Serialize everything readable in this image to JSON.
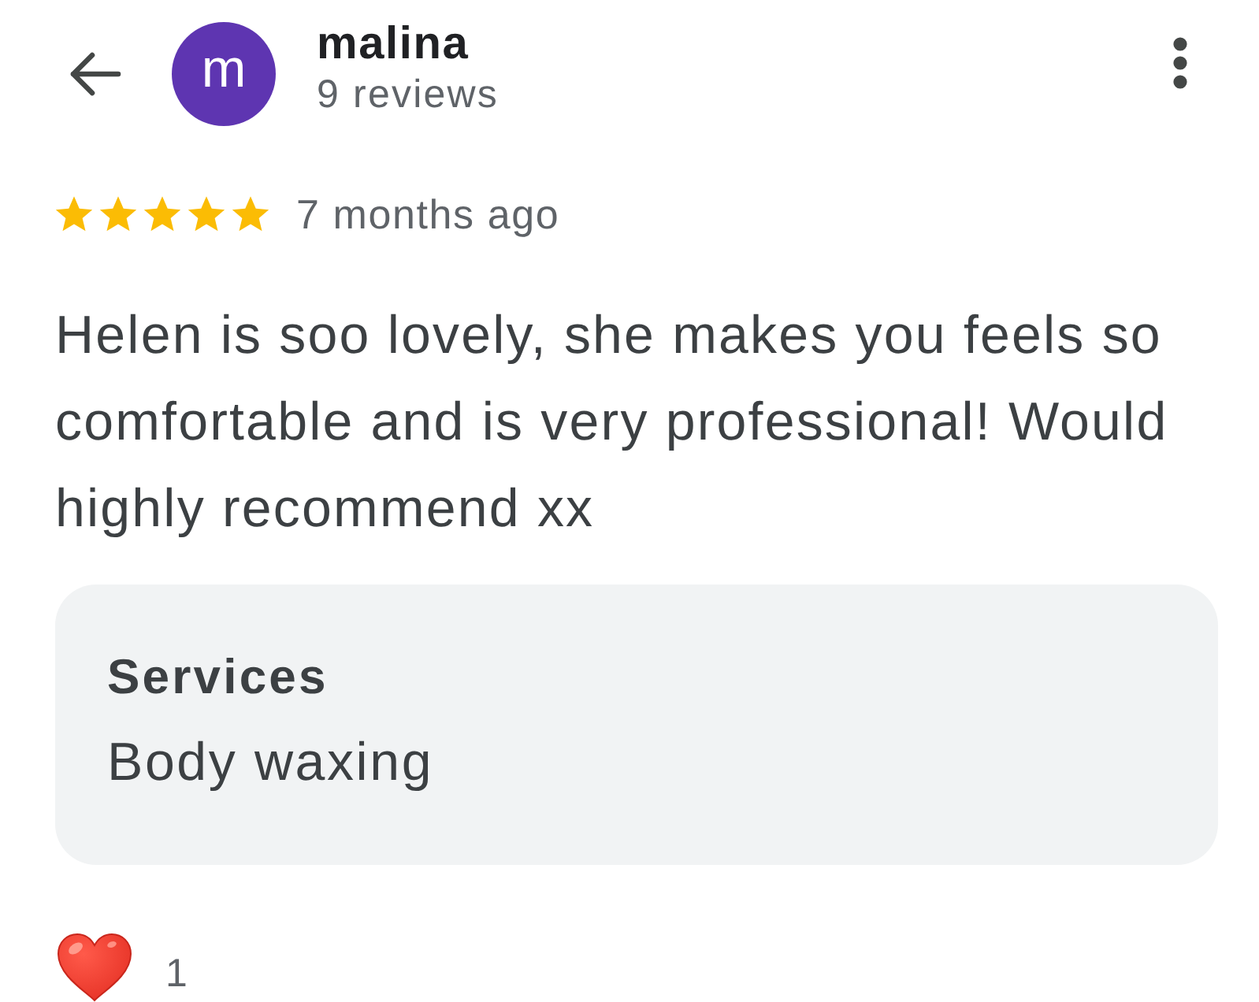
{
  "reviewer": {
    "initial": "m",
    "name": "malina",
    "review_count": "9 reviews"
  },
  "review": {
    "stars": 5,
    "time": "7 months ago",
    "text": "Helen is soo lovely, she makes you feels so comfortable and is very professional! Would highly recommend xx"
  },
  "services": {
    "heading": "Services",
    "value": "Body waxing"
  },
  "reactions": [
    {
      "kind": "heart",
      "count": "1"
    }
  ]
}
